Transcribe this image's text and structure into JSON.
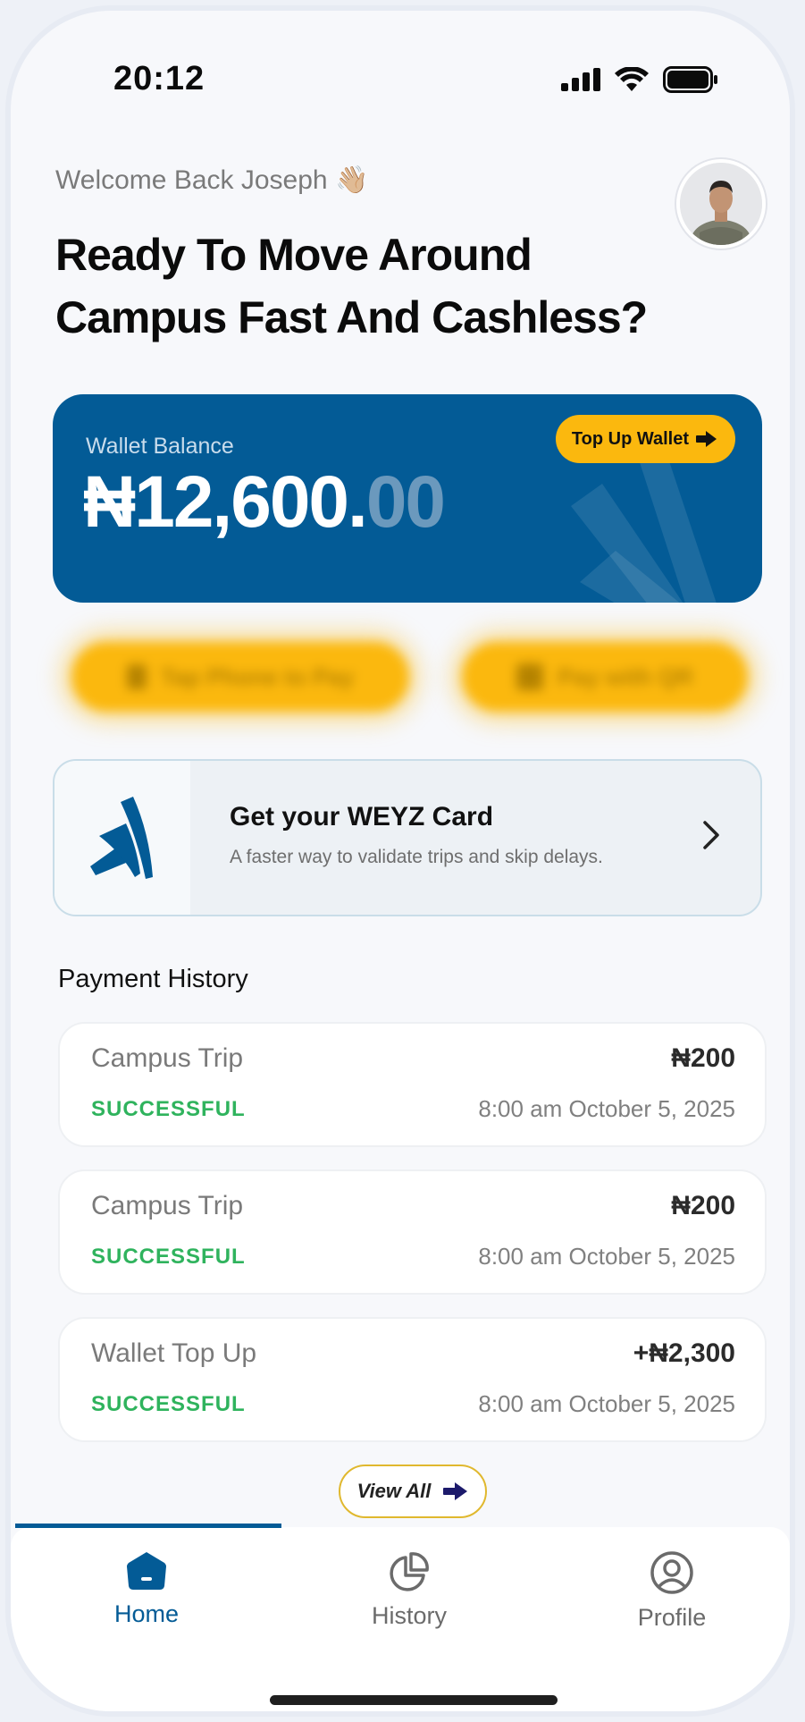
{
  "status_bar": {
    "time": "20:12"
  },
  "header": {
    "welcome": "Welcome Back Joseph",
    "welcome_emoji": "👋🏼",
    "headline_line1": "Ready To Move Around",
    "headline_line2": "Campus Fast And Cashless?"
  },
  "wallet": {
    "label": "Wallet Balance",
    "amount_main": "₦12,600.",
    "amount_decimals": "00",
    "topup_label": "Top Up Wallet",
    "bg_color": "#035b96",
    "accent_color": "#fbb80e"
  },
  "quick_actions": [
    {
      "label": "Tap Phone to Pay",
      "icon": "nfc-icon"
    },
    {
      "label": "Pay with QR",
      "icon": "qr-icon"
    }
  ],
  "card_promo": {
    "title": "Get your WEYZ Card",
    "subtitle": "A faster way to validate trips and skip delays."
  },
  "payment_history": {
    "title": "Payment History",
    "items": [
      {
        "name": "Campus Trip",
        "amount": "₦200",
        "status": "SUCCESSFUL",
        "date": "8:00 am October 5, 2025"
      },
      {
        "name": "Campus Trip",
        "amount": "₦200",
        "status": "SUCCESSFUL",
        "date": "8:00 am October 5, 2025"
      },
      {
        "name": "Wallet Top Up",
        "amount": "+₦2,300",
        "status": "SUCCESSFUL",
        "date": "8:00 am October 5, 2025"
      }
    ],
    "view_all_label": "View All"
  },
  "nav": {
    "items": [
      {
        "label": "Home",
        "icon": "home-icon",
        "active": true
      },
      {
        "label": "History",
        "icon": "history-icon",
        "active": false
      },
      {
        "label": "Profile",
        "icon": "profile-icon",
        "active": false
      }
    ]
  }
}
